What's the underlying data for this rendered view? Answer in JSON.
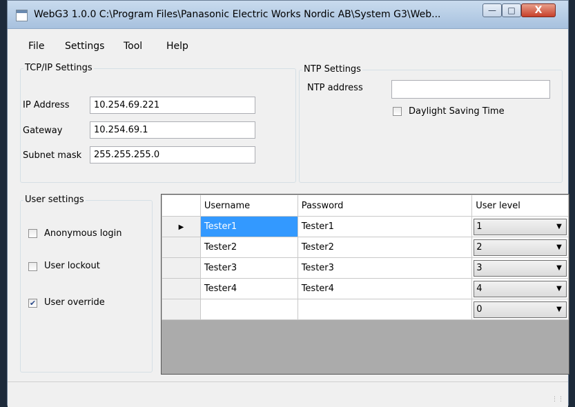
{
  "window": {
    "title": "WebG3 1.0.0 C:\\Program Files\\Panasonic Electric Works Nordic AB\\System G3\\Web...",
    "min_glyph": "—",
    "max_glyph": "□",
    "close_glyph": "X"
  },
  "menu": {
    "file": "File",
    "settings": "Settings",
    "tool": "Tool",
    "help": "Help"
  },
  "tcpip": {
    "title": "TCP/IP Settings",
    "ip_label": "IP Address",
    "ip_value": "10.254.69.221",
    "gateway_label": "Gateway",
    "gateway_value": "10.254.69.1",
    "subnet_label": "Subnet mask",
    "subnet_value": "255.255.255.0"
  },
  "ntp": {
    "title": "NTP Settings",
    "address_label": "NTP address",
    "address_value": "",
    "dst_label": "Daylight Saving Time",
    "dst_checked": false
  },
  "user_settings": {
    "title": "User settings",
    "anonymous_label": "Anonymous login",
    "anonymous_checked": false,
    "lockout_label": "User lockout",
    "lockout_checked": false,
    "override_label": "User override",
    "override_checked": true
  },
  "grid": {
    "columns": [
      "Username",
      "Password",
      "User level"
    ],
    "current_row_marker": "▶",
    "rows": [
      {
        "username": "Tester1",
        "password": "Tester1",
        "level": "1"
      },
      {
        "username": "Tester2",
        "password": "Tester2",
        "level": "2"
      },
      {
        "username": "Tester3",
        "password": "Tester3",
        "level": "3"
      },
      {
        "username": "Tester4",
        "password": "Tester4",
        "level": "4"
      },
      {
        "username": "",
        "password": "",
        "level": "0"
      }
    ],
    "dropdown_glyph": "▼"
  },
  "icons": {
    "app": "app-icon",
    "check": "✔"
  }
}
